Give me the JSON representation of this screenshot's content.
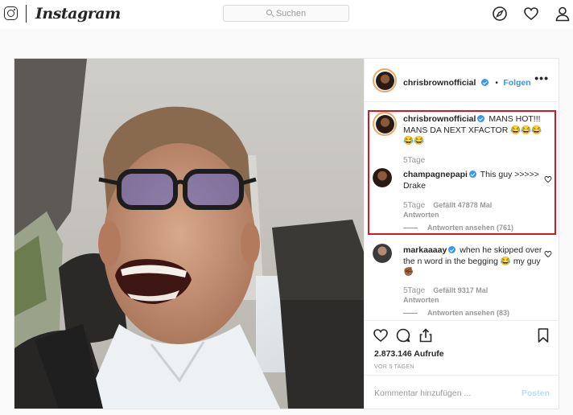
{
  "topbar": {
    "brand": "Instagram",
    "search_placeholder": "Suchen",
    "icons": [
      "instagram-logo-icon",
      "compass-icon",
      "heart-icon",
      "profile-icon"
    ]
  },
  "post": {
    "author": "chrisbrownofficial",
    "follow_label": "Folgen",
    "more_label": "•••",
    "comments": [
      {
        "username": "chrisbrownofficial",
        "verified": true,
        "text": "MANS HOT!!! MANS DA NEXT XFACTOR 😂😂😂😂😂",
        "time": "5Tage"
      },
      {
        "username": "champagnepapi",
        "verified": true,
        "text": "This guy >>>>> Drake",
        "time": "5Tage",
        "likes": "Gefällt 47878 Mal",
        "reply_label": "Antworten",
        "view_replies": "Antworten ansehen (761)"
      },
      {
        "username": "markaaaay",
        "verified": true,
        "text": "when he skipped over the n word in the begging 😂 my guy ✊🏾",
        "time": "5Tage",
        "likes": "Gefällt 9317 Mal",
        "reply_label": "Antworten",
        "view_replies": "Antworten ansehen (83)"
      }
    ],
    "views": "2.873.146 Aufrufe",
    "posted_ago": "VOR 5 TAGEN",
    "comment_placeholder": "Kommentar hinzufügen ...",
    "post_button": "Posten",
    "highlight_color": "#cc1b22"
  }
}
